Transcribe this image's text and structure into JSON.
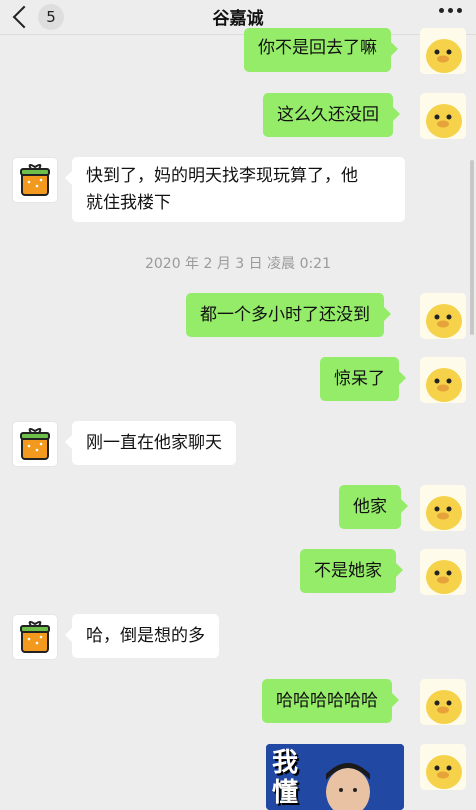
{
  "header": {
    "back_count": "5",
    "title": "谷嘉诚",
    "more_icon": "more-dots-icon"
  },
  "timestamp": "2020 年 2 月 3 日 凌晨 0:21",
  "messages": [
    {
      "side": "right",
      "text": "你不是回去了嘛"
    },
    {
      "side": "right",
      "text": "这么久还没回"
    },
    {
      "side": "left",
      "lines": [
        "快到了，妈的明天找李现玩算了，他",
        "就住我楼下"
      ]
    },
    {
      "side": "right",
      "text": "都一个多小时了还没到"
    },
    {
      "side": "right",
      "text": "惊呆了"
    },
    {
      "side": "left",
      "text": "刚一直在他家聊天"
    },
    {
      "side": "right",
      "text": "他家"
    },
    {
      "side": "right",
      "text": "不是她家"
    },
    {
      "side": "left",
      "text": "哈，倒是想的多"
    },
    {
      "side": "right",
      "text": "哈哈哈哈哈哈"
    },
    {
      "side": "right",
      "image_text": "我 懂"
    }
  ],
  "colors": {
    "sent_bubble": "#95ec69",
    "received_bubble": "#ffffff",
    "background": "#ededed"
  }
}
